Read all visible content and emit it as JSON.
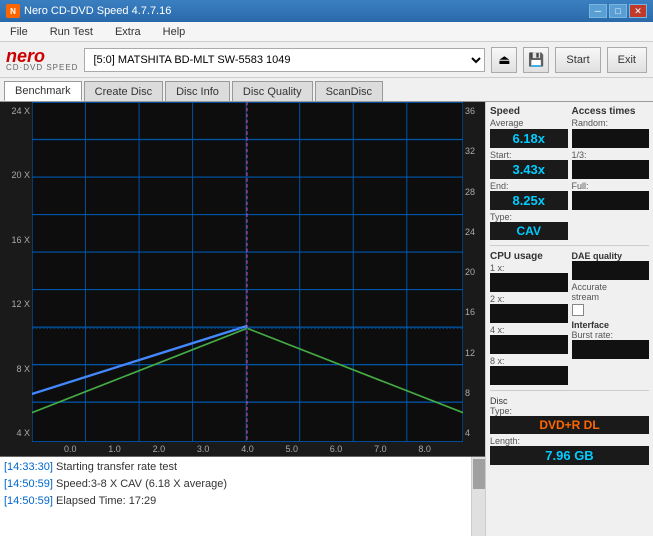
{
  "titlebar": {
    "title": "Nero CD-DVD Speed 4.7.7.16",
    "icon": "N",
    "btn_minimize": "─",
    "btn_maximize": "□",
    "btn_close": "✕"
  },
  "menubar": {
    "items": [
      "File",
      "Run Test",
      "Extra",
      "Help"
    ]
  },
  "toolbar": {
    "drive_label": "[5:0]  MATSHITA BD-MLT SW-5583 1049",
    "start_label": "Start",
    "exit_label": "Exit"
  },
  "tabs": [
    "Benchmark",
    "Create Disc",
    "Disc Info",
    "Disc Quality",
    "ScanDisc"
  ],
  "active_tab": "Benchmark",
  "right_panel": {
    "speed_label": "Speed",
    "average_label": "Average",
    "average_value": "6.18x",
    "start_label": "Start:",
    "start_value": "3.43x",
    "end_label": "End:",
    "end_value": "8.25x",
    "type_label": "Type:",
    "type_value": "CAV",
    "dae_label": "DAE quality",
    "dae_value": "",
    "accurate_label": "Accurate",
    "stream_label": "stream",
    "disc_label": "Disc",
    "disc_type_label": "Type:",
    "disc_type_value": "DVD+R DL",
    "length_label": "Length:",
    "length_value": "7.96 GB",
    "access_label": "Access times",
    "random_label": "Random:",
    "random_value": "",
    "onethird_label": "1/3:",
    "onethird_value": "",
    "full_label": "Full:",
    "full_value": "",
    "cpu_label": "CPU usage",
    "cpu_1x_label": "1 x:",
    "cpu_1x_value": "",
    "cpu_2x_label": "2 x:",
    "cpu_2x_value": "",
    "cpu_4x_label": "4 x:",
    "cpu_4x_value": "",
    "cpu_8x_label": "8 x:",
    "cpu_8x_value": "",
    "interface_label": "Interface",
    "burst_label": "Burst rate:",
    "burst_value": ""
  },
  "chart": {
    "y_left": [
      "24 X",
      "20 X",
      "16 X",
      "12 X",
      "8 X",
      "4 X"
    ],
    "y_right": [
      "36",
      "32",
      "28",
      "24",
      "20",
      "16",
      "12",
      "8",
      "4"
    ],
    "x_labels": [
      "0.0",
      "1.0",
      "2.0",
      "3.0",
      "4.0",
      "5.0",
      "6.0",
      "7.0",
      "8.0"
    ]
  },
  "log": {
    "entries": [
      {
        "time": "[14:33:30]",
        "msg": "Starting transfer rate test"
      },
      {
        "time": "[14:50:59]",
        "msg": "Speed:3-8 X CAV (6.18 X average)"
      },
      {
        "time": "[14:50:59]",
        "msg": "Elapsed Time: 17:29"
      }
    ]
  }
}
